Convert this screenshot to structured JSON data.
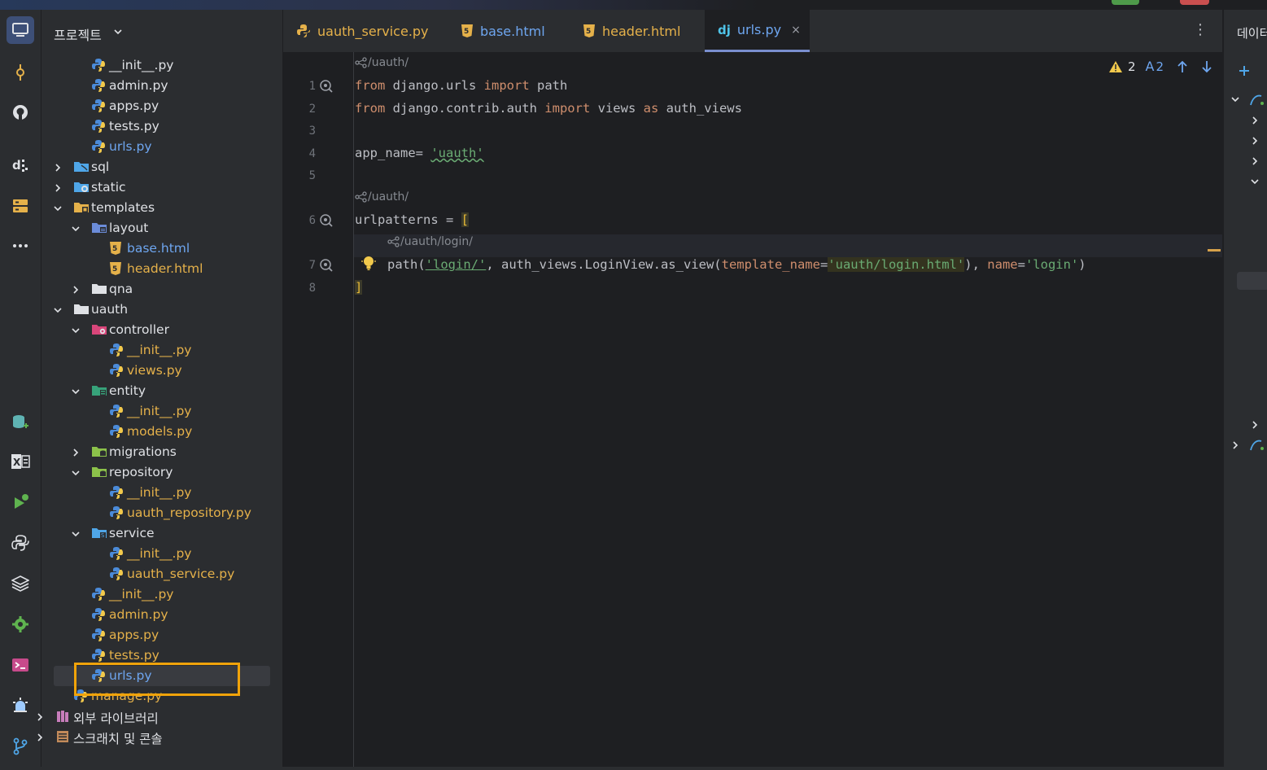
{
  "project_panel": {
    "title": "프로젝트",
    "tree": [
      {
        "label": "__init__.py",
        "type": "py",
        "depth": 3,
        "row": 0
      },
      {
        "label": "admin.py",
        "type": "py",
        "depth": 3,
        "row": 1
      },
      {
        "label": "apps.py",
        "type": "py",
        "depth": 3,
        "row": 2
      },
      {
        "label": "tests.py",
        "type": "py",
        "depth": 3,
        "row": 3
      },
      {
        "label": "urls.py",
        "type": "py-modified",
        "depth": 3,
        "row": 4
      },
      {
        "label": "sql",
        "type": "folder-sql",
        "depth": 2,
        "expanded": false,
        "row": 5
      },
      {
        "label": "static",
        "type": "folder-static",
        "depth": 2,
        "expanded": false,
        "row": 6
      },
      {
        "label": "templates",
        "type": "folder-templates",
        "depth": 2,
        "expanded": true,
        "row": 7
      },
      {
        "label": "layout",
        "type": "folder-layout",
        "depth": 3,
        "expanded": true,
        "row": 8
      },
      {
        "label": "base.html",
        "type": "html-modified",
        "depth": 4,
        "row": 9
      },
      {
        "label": "header.html",
        "type": "html",
        "depth": 4,
        "row": 10
      },
      {
        "label": "qna",
        "type": "folder",
        "depth": 3,
        "expanded": false,
        "row": 11
      },
      {
        "label": "uauth",
        "type": "folder",
        "depth": 2,
        "expanded": true,
        "row": 12
      },
      {
        "label": "controller",
        "type": "folder-controller",
        "depth": 3,
        "expanded": true,
        "row": 13
      },
      {
        "label": "__init__.py",
        "type": "py",
        "depth": 4,
        "row": 14
      },
      {
        "label": "views.py",
        "type": "py",
        "depth": 4,
        "row": 15
      },
      {
        "label": "entity",
        "type": "folder-entity",
        "depth": 3,
        "expanded": true,
        "row": 16
      },
      {
        "label": "__init__.py",
        "type": "py",
        "depth": 4,
        "row": 17
      },
      {
        "label": "models.py",
        "type": "py",
        "depth": 4,
        "row": 18
      },
      {
        "label": "migrations",
        "type": "folder-db",
        "depth": 3,
        "expanded": false,
        "row": 19
      },
      {
        "label": "repository",
        "type": "folder-db",
        "depth": 3,
        "expanded": true,
        "row": 20
      },
      {
        "label": "__init__.py",
        "type": "py",
        "depth": 4,
        "row": 21
      },
      {
        "label": "uauth_repository.py",
        "type": "py",
        "depth": 4,
        "row": 22
      },
      {
        "label": "service",
        "type": "folder-service",
        "depth": 3,
        "expanded": true,
        "row": 23
      },
      {
        "label": "__init__.py",
        "type": "py",
        "depth": 4,
        "row": 24
      },
      {
        "label": "uauth_service.py",
        "type": "py",
        "depth": 4,
        "row": 25
      },
      {
        "label": "__init__.py",
        "type": "py",
        "depth": 3,
        "row": 26
      },
      {
        "label": "admin.py",
        "type": "py",
        "depth": 3,
        "row": 27
      },
      {
        "label": "apps.py",
        "type": "py",
        "depth": 3,
        "row": 28
      },
      {
        "label": "tests.py",
        "type": "py",
        "depth": 3,
        "row": 29
      },
      {
        "label": "urls.py",
        "type": "py",
        "depth": 3,
        "row": 30,
        "selected": true
      },
      {
        "label": "manage.py",
        "type": "py",
        "depth": 2,
        "row": 31
      },
      {
        "label": "외부 라이브러리",
        "type": "library",
        "depth": 1,
        "expanded": false,
        "row": 32
      },
      {
        "label": "스크래치 및 콘솔",
        "type": "scratch",
        "depth": 1,
        "expanded": false,
        "row": 33
      }
    ]
  },
  "tabs": [
    {
      "label": "uauth_service.py",
      "type": "py"
    },
    {
      "label": "base.html",
      "type": "html-modified"
    },
    {
      "label": "header.html",
      "type": "html"
    },
    {
      "label": "urls.py",
      "type": "django",
      "active": true,
      "close": "×"
    }
  ],
  "editor": {
    "inspections": {
      "warnings": "2",
      "typos": "2"
    },
    "hints": {
      "route1": "/uauth/",
      "route2": "/uauth/",
      "route3": "/uauth/login/"
    },
    "line_numbers": [
      "1",
      "2",
      "3",
      "4",
      "5",
      "6",
      "7",
      "8"
    ],
    "code": {
      "l1_kw1": "from",
      "l1_mod": " django.urls ",
      "l1_kw2": "import",
      "l1_name": " path",
      "l2_kw1": "from",
      "l2_mod": " django.contrib.auth ",
      "l2_kw2": "import",
      "l2_mid": " views ",
      "l2_kw3": "as",
      "l2_name": " auth_views",
      "l4_var": "app_name= ",
      "l4_str": "'uauth'",
      "l6_var": "urlpatterns = ",
      "l6_br": "[",
      "l7_a": "path(",
      "l7_s1": "'login/'",
      "l7_b": ", auth_views.LoginView.as_view(",
      "l7_p1": "template_name",
      "l7_eq": "=",
      "l7_s2": "'uauth/login.html'",
      "l7_c": "), ",
      "l7_p2": "name",
      "l7_eq2": "=",
      "l7_s3": "'login'",
      "l7_d": ")",
      "l8_br": "]"
    }
  },
  "right_panel": {
    "title": "데이터"
  },
  "colors": {
    "accent": "#3d4f77",
    "keyword": "#cf8e6d",
    "string": "#6aab73",
    "param": "#c77dbb",
    "highlight_box": "#f0a30a"
  }
}
